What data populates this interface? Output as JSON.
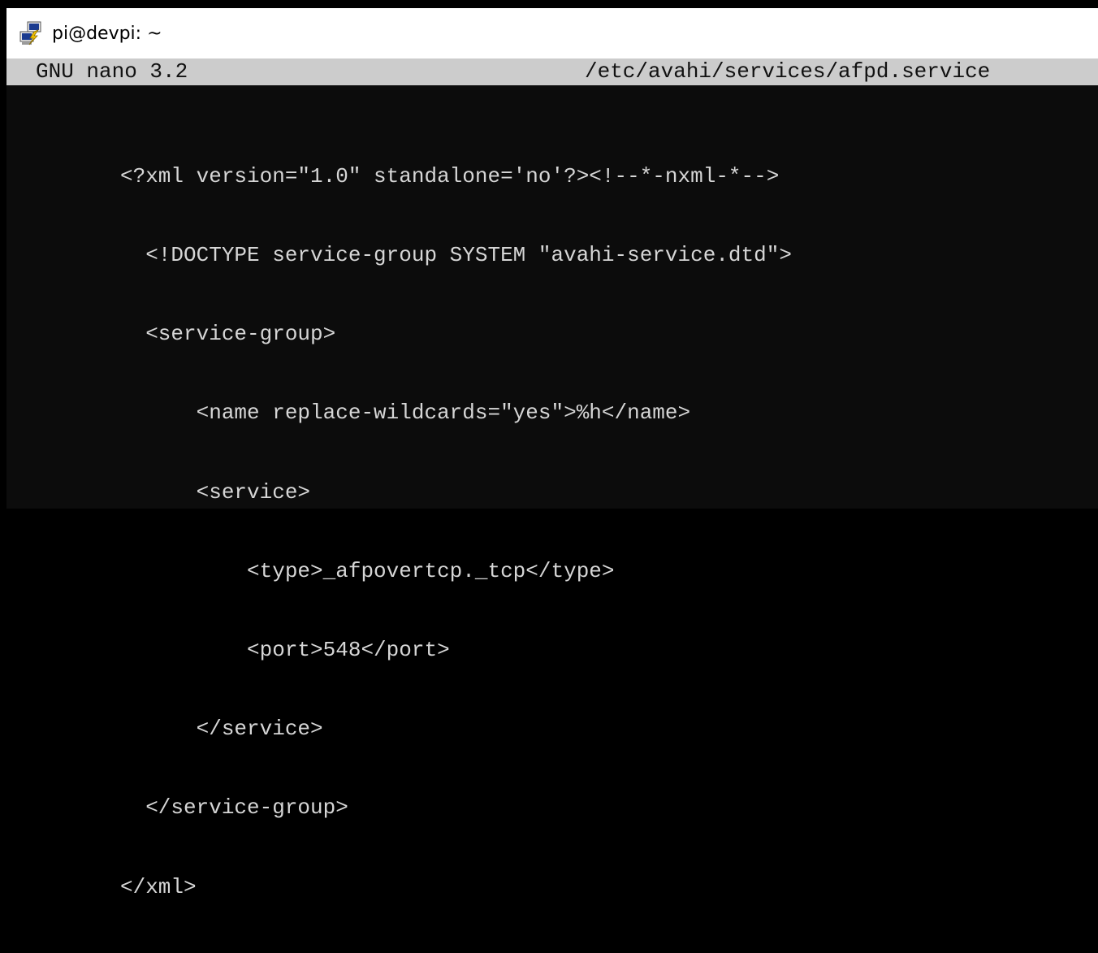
{
  "window": {
    "title": "pi@devpi: ~",
    "icon": "putty-terminal-icon"
  },
  "nano": {
    "version": "GNU nano 3.2",
    "filename": "/etc/avahi/services/afpd.service"
  },
  "editor": {
    "lines": [
      "<?xml version=\"1.0\" standalone='no'?><!--*-nxml-*-->",
      "  <!DOCTYPE service-group SYSTEM \"avahi-service.dtd\">",
      "  <service-group>",
      "      <name replace-wildcards=\"yes\">%h</name>",
      "      <service>",
      "          <type>_afpovertcp._tcp</type>",
      "          <port>548</port>",
      "      </service>",
      "  </service-group>",
      "</xml>"
    ]
  },
  "colors": {
    "terminal_background": "#0c0c0c",
    "terminal_text": "#d6d6d6",
    "nano_header_background": "#cccccc",
    "titlebar_background": "#ffffff"
  }
}
